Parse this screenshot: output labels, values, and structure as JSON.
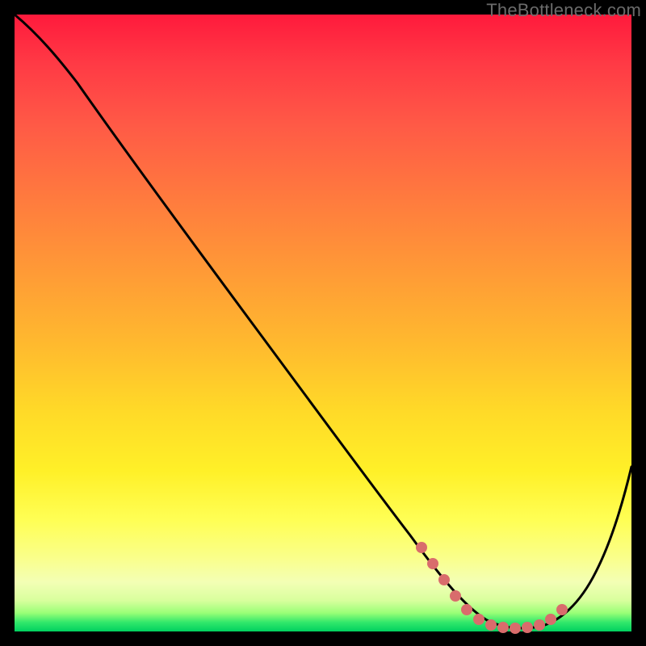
{
  "watermark": "TheBottleneck.com",
  "chart_data": {
    "type": "line",
    "title": "",
    "xlabel": "",
    "ylabel": "",
    "xlim": [
      0,
      100
    ],
    "ylim": [
      0,
      100
    ],
    "grid": false,
    "legend": false,
    "background_gradient": {
      "orientation": "vertical",
      "stops": [
        {
          "pos": 0,
          "color": "#ff1a3c"
        },
        {
          "pos": 30,
          "color": "#ff7b3e"
        },
        {
          "pos": 64,
          "color": "#ffd928"
        },
        {
          "pos": 88,
          "color": "#faff8a"
        },
        {
          "pos": 100,
          "color": "#00d060"
        }
      ]
    },
    "series": [
      {
        "name": "main-curve",
        "color": "#000000",
        "x": [
          0,
          5,
          10,
          20,
          30,
          40,
          50,
          60,
          66,
          70,
          74,
          78,
          82,
          86,
          90,
          95,
          100
        ],
        "values": [
          100,
          97,
          92,
          80,
          67,
          54,
          41,
          28,
          18,
          12,
          6,
          3,
          2,
          2,
          5,
          15,
          28
        ]
      },
      {
        "name": "highlight-dots",
        "color": "#d86a6a",
        "marker": "circle",
        "x": [
          66,
          68,
          70,
          72,
          74,
          76,
          78,
          80,
          82,
          84,
          86,
          88,
          90
        ],
        "values": [
          18,
          15,
          12,
          9,
          6,
          4,
          3,
          2,
          2,
          2,
          2,
          3,
          5
        ]
      }
    ]
  }
}
